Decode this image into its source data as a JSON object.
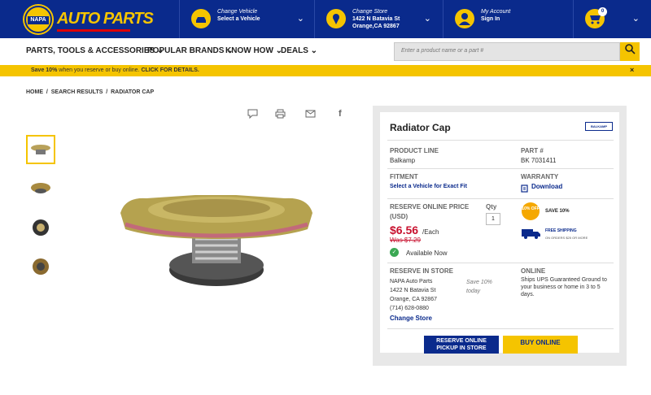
{
  "header": {
    "logo": "NAPA",
    "logo_text": "AUTO PARTS",
    "vehicle": {
      "title": "Change Vehicle",
      "sub": "Select a Vehicle"
    },
    "store": {
      "title": "Change Store",
      "line1": "1422 N Batavia St",
      "line2": "Orange,CA 92867"
    },
    "account": {
      "title": "My Account",
      "sub": "Sign In"
    },
    "cart_count": "0",
    "icons": [
      "car-icon",
      "location-pin-icon",
      "user-icon",
      "cart-icon"
    ]
  },
  "nav": {
    "items": [
      "PARTS, TOOLS & ACCESSORIES ⌄",
      "POPULAR BRANDS ⌄",
      "KNOW HOW ⌄",
      "DEALS ⌄"
    ],
    "search_placeholder": "Enter a product name or a part #"
  },
  "promo": {
    "bold": "Save 10%",
    "text": " when you reserve or buy online. ",
    "cta": "CLICK FOR DETAILS.",
    "close": "×"
  },
  "breadcrumb": [
    "HOME",
    "SEARCH RESULTS",
    "RADIATOR CAP"
  ],
  "product": {
    "title": "Radiator Cap",
    "brand_logo": "BALKAMP",
    "product_line_label": "PRODUCT LINE",
    "product_line": "Balkamp",
    "part_label": "PART #",
    "part_no": "BK 7031411",
    "fitment_label": "FITMENT",
    "fitment_link": "Select a Vehicle for Exact Fit",
    "warranty_label": "WARRANTY",
    "warranty_link": "Download",
    "price_label": "RESERVE ONLINE PRICE",
    "price_unit": "(USD)",
    "qty_label": "Qty",
    "qty": "1",
    "price": "$6.56",
    "per": "/Each",
    "was": "Was $7.29",
    "availability": "Available Now",
    "save_badge": "10% OFF",
    "save_text": "SAVE 10%",
    "free_ship": "FREE SHIPPING",
    "free_ship_sub": "ON ORDERS $25 OR MORE",
    "store_label": "RESERVE IN STORE",
    "store_lines": [
      "NAPA Auto Parts",
      "1422 N Batavia St",
      "Orange, CA 92867",
      "(714) 628-0880"
    ],
    "store_save": "Save 10% today",
    "change_store": "Change Store",
    "online_label": "ONLINE",
    "online_text": [
      "Ships UPS Guaranteed Ground to",
      "your business or home in 3 to 5",
      "days."
    ],
    "reserve_btn": [
      "RESERVE ONLINE",
      "PICKUP IN STORE"
    ],
    "buy_btn": "BUY ONLINE"
  },
  "colors": {
    "navy": "#0a2a8c",
    "yellow": "#f5c400",
    "red": "#c8102e",
    "green": "#3aa853"
  }
}
